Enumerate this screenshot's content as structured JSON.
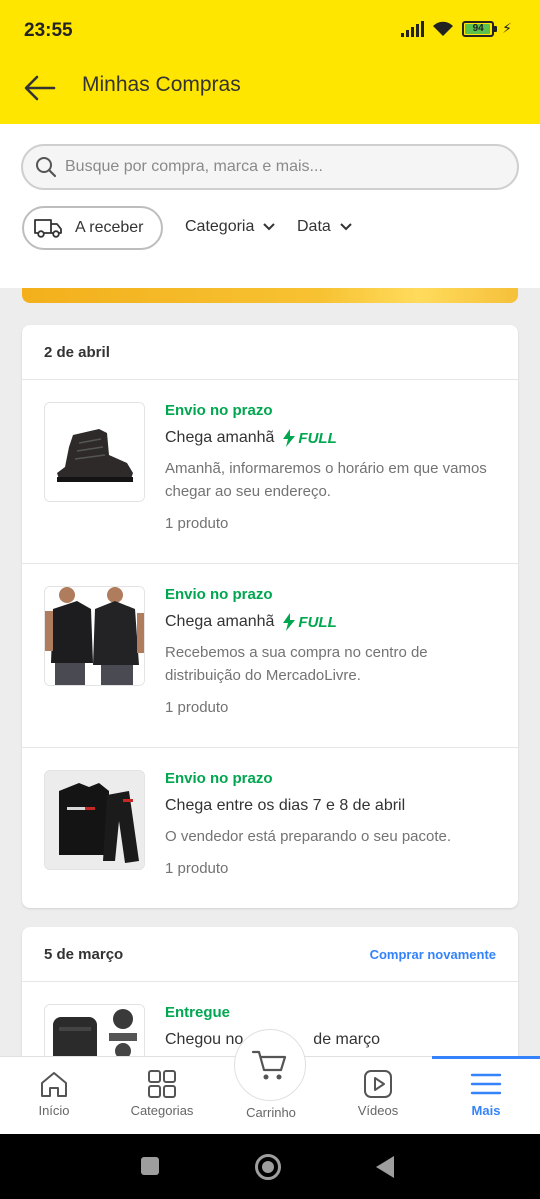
{
  "status_bar": {
    "time": "23:55",
    "battery": "94"
  },
  "header": {
    "title": "Minhas Compras"
  },
  "search": {
    "placeholder": "Busque por compra, marca e mais..."
  },
  "filters": {
    "receive_chip": "A receber",
    "category": "Categoria",
    "date": "Data"
  },
  "groups": [
    {
      "date": "2 de abril",
      "items": [
        {
          "status": "Envio no prazo",
          "arrival": "Chega amanhã",
          "full": "FULL",
          "description": "Amanhã, informaremos o horário em que vamos chegar ao seu endereço.",
          "count": "1 produto"
        },
        {
          "status": "Envio no prazo",
          "arrival": "Chega amanhã",
          "full": "FULL",
          "description": "Recebemos a sua compra no centro de distribuição do MercadoLivre.",
          "count": "1 produto"
        },
        {
          "status": "Envio no prazo",
          "arrival": "Chega entre os dias 7 e 8 de abril",
          "description": "O vendedor está preparando o seu pacote.",
          "count": "1 produto"
        }
      ]
    },
    {
      "date": "5 de março",
      "action": "Comprar novamente",
      "items": [
        {
          "status": "Entregue",
          "arrival": "Chegou no",
          "arrival_end": "de março"
        }
      ]
    }
  ],
  "tabbar": {
    "items": [
      {
        "label": "Início",
        "icon": "home-icon"
      },
      {
        "label": "Categorias",
        "icon": "grid-icon"
      },
      {
        "label": "Carrinho",
        "icon": "cart-icon"
      },
      {
        "label": "Vídeos",
        "icon": "play-icon"
      },
      {
        "label": "Mais",
        "icon": "menu-icon"
      }
    ],
    "active": "Mais"
  },
  "colors": {
    "brand_yellow": "#ffe600",
    "green": "#00a650",
    "blue": "#3483fa"
  }
}
